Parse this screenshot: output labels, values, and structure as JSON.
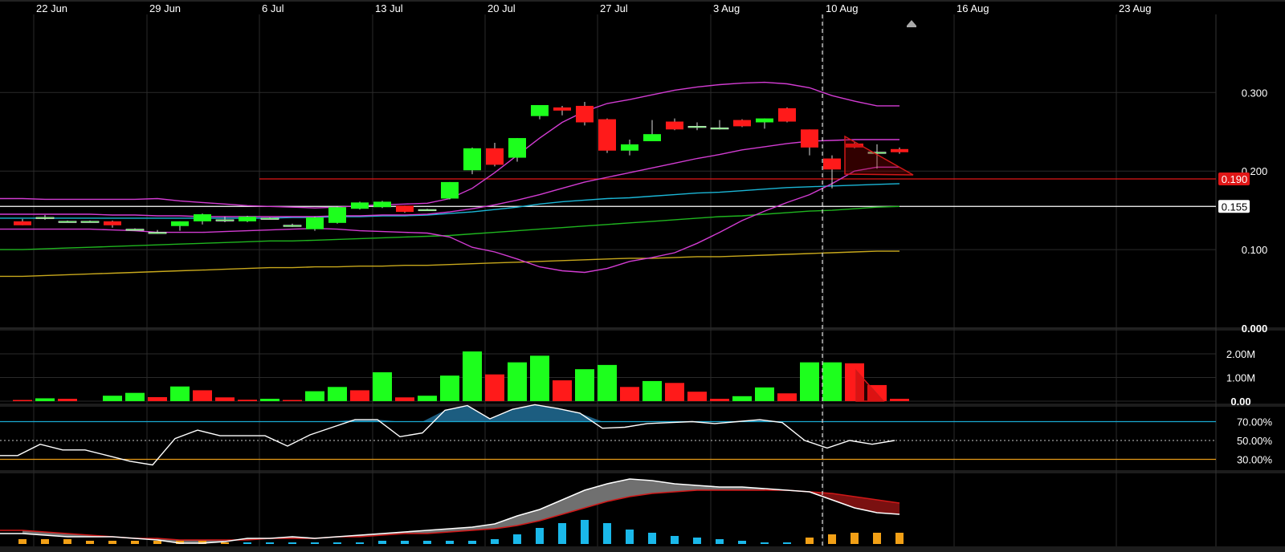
{
  "colors": {
    "background": "#000000",
    "grid": "#2a2a2a",
    "up": "#1dff1d",
    "down": "#ff1a1a",
    "bollinger": "#d23cd2",
    "ma_cyan": "#1bb6d6",
    "ma_green": "#1fb51f",
    "ma_yellow": "#c8a81c",
    "rsi_line": "#ffffff",
    "rsi_upper": "#1aa9d0",
    "rsi_lower": "#e89a18",
    "macd_line": "#ffffff",
    "macd_signal": "#d01818",
    "macd_hist_pos": "#1ab8ea",
    "macd_hist_neg": "#f2a016",
    "h_line_red": "#e01616",
    "h_line_white": "#ffffff"
  },
  "chart_data": [
    {
      "type": "candlestick",
      "panel": "price",
      "x_axis_labels": [
        "22 Jun",
        "29 Jun",
        "6 Jul",
        "13 Jul",
        "20 Jul",
        "27 Jul",
        "3 Aug",
        "10 Aug",
        "16 Aug",
        "23 Aug"
      ],
      "y_tick_labels": [
        "0.300",
        "0.200",
        "0.100",
        "0.000"
      ],
      "ylim": [
        0.0,
        0.3
      ],
      "h_levels": [
        {
          "value": 0.19,
          "label": "0.190",
          "color": "red"
        },
        {
          "value": 0.155,
          "label": "0.155",
          "color": "white"
        }
      ],
      "candles": [
        {
          "o": 0.136,
          "h": 0.139,
          "l": 0.131,
          "c": 0.131
        },
        {
          "o": 0.141,
          "h": 0.144,
          "l": 0.138,
          "c": 0.141
        },
        {
          "o": 0.136,
          "h": 0.137,
          "l": 0.135,
          "c": 0.136
        },
        {
          "o": 0.136,
          "h": 0.137,
          "l": 0.135,
          "c": 0.136
        },
        {
          "o": 0.136,
          "h": 0.137,
          "l": 0.128,
          "c": 0.131
        },
        {
          "o": 0.126,
          "h": 0.127,
          "l": 0.124,
          "c": 0.126
        },
        {
          "o": 0.122,
          "h": 0.125,
          "l": 0.12,
          "c": 0.122
        },
        {
          "o": 0.13,
          "h": 0.136,
          "l": 0.124,
          "c": 0.136
        },
        {
          "o": 0.136,
          "h": 0.146,
          "l": 0.132,
          "c": 0.145
        },
        {
          "o": 0.138,
          "h": 0.142,
          "l": 0.135,
          "c": 0.138
        },
        {
          "o": 0.136,
          "h": 0.143,
          "l": 0.135,
          "c": 0.142
        },
        {
          "o": 0.14,
          "h": 0.141,
          "l": 0.139,
          "c": 0.14
        },
        {
          "o": 0.131,
          "h": 0.133,
          "l": 0.129,
          "c": 0.131
        },
        {
          "o": 0.126,
          "h": 0.142,
          "l": 0.124,
          "c": 0.141
        },
        {
          "o": 0.134,
          "h": 0.155,
          "l": 0.133,
          "c": 0.154
        },
        {
          "o": 0.152,
          "h": 0.161,
          "l": 0.151,
          "c": 0.16
        },
        {
          "o": 0.154,
          "h": 0.162,
          "l": 0.153,
          "c": 0.161
        },
        {
          "o": 0.156,
          "h": 0.156,
          "l": 0.147,
          "c": 0.148
        },
        {
          "o": 0.151,
          "h": 0.152,
          "l": 0.15,
          "c": 0.151
        },
        {
          "o": 0.165,
          "h": 0.186,
          "l": 0.164,
          "c": 0.186
        },
        {
          "o": 0.201,
          "h": 0.23,
          "l": 0.196,
          "c": 0.229
        },
        {
          "o": 0.229,
          "h": 0.236,
          "l": 0.206,
          "c": 0.208
        },
        {
          "o": 0.217,
          "h": 0.242,
          "l": 0.212,
          "c": 0.242
        },
        {
          "o": 0.27,
          "h": 0.284,
          "l": 0.266,
          "c": 0.284
        },
        {
          "o": 0.281,
          "h": 0.283,
          "l": 0.271,
          "c": 0.277
        },
        {
          "o": 0.283,
          "h": 0.288,
          "l": 0.258,
          "c": 0.262
        },
        {
          "o": 0.266,
          "h": 0.267,
          "l": 0.223,
          "c": 0.226
        },
        {
          "o": 0.226,
          "h": 0.24,
          "l": 0.22,
          "c": 0.234
        },
        {
          "o": 0.238,
          "h": 0.265,
          "l": 0.238,
          "c": 0.247
        },
        {
          "o": 0.263,
          "h": 0.267,
          "l": 0.252,
          "c": 0.253
        },
        {
          "o": 0.257,
          "h": 0.262,
          "l": 0.252,
          "c": 0.257
        },
        {
          "o": 0.255,
          "h": 0.265,
          "l": 0.253,
          "c": 0.255
        },
        {
          "o": 0.265,
          "h": 0.266,
          "l": 0.256,
          "c": 0.257
        },
        {
          "o": 0.262,
          "h": 0.267,
          "l": 0.254,
          "c": 0.267
        },
        {
          "o": 0.28,
          "h": 0.281,
          "l": 0.262,
          "c": 0.263
        },
        {
          "o": 0.253,
          "h": 0.253,
          "l": 0.22,
          "c": 0.23
        },
        {
          "o": 0.216,
          "h": 0.22,
          "l": 0.178,
          "c": 0.202
        },
        {
          "o": 0.235,
          "h": 0.238,
          "l": 0.229,
          "c": 0.23
        },
        {
          "o": 0.224,
          "h": 0.234,
          "l": 0.203,
          "c": 0.224
        },
        {
          "o": 0.228,
          "h": 0.23,
          "l": 0.222,
          "c": 0.224
        }
      ],
      "bollinger_upper": [
        0.165,
        0.164,
        0.164,
        0.164,
        0.164,
        0.164,
        0.165,
        0.162,
        0.16,
        0.158,
        0.156,
        0.155,
        0.154,
        0.153,
        0.154,
        0.156,
        0.157,
        0.158,
        0.159,
        0.165,
        0.178,
        0.198,
        0.22,
        0.242,
        0.262,
        0.276,
        0.286,
        0.291,
        0.297,
        0.303,
        0.307,
        0.31,
        0.312,
        0.313,
        0.311,
        0.306,
        0.296,
        0.289,
        0.283,
        0.283
      ],
      "bollinger_mid": [
        0.145,
        0.145,
        0.145,
        0.145,
        0.144,
        0.144,
        0.143,
        0.143,
        0.142,
        0.142,
        0.142,
        0.142,
        0.142,
        0.142,
        0.143,
        0.143,
        0.144,
        0.144,
        0.145,
        0.148,
        0.152,
        0.157,
        0.163,
        0.17,
        0.178,
        0.186,
        0.192,
        0.198,
        0.204,
        0.21,
        0.216,
        0.221,
        0.227,
        0.231,
        0.235,
        0.238,
        0.239,
        0.24,
        0.24,
        0.24
      ],
      "bollinger_lower": [
        0.126,
        0.126,
        0.126,
        0.126,
        0.125,
        0.124,
        0.122,
        0.122,
        0.122,
        0.123,
        0.124,
        0.125,
        0.126,
        0.127,
        0.126,
        0.124,
        0.123,
        0.122,
        0.121,
        0.116,
        0.103,
        0.097,
        0.088,
        0.078,
        0.073,
        0.071,
        0.076,
        0.085,
        0.09,
        0.096,
        0.108,
        0.122,
        0.137,
        0.149,
        0.16,
        0.17,
        0.184,
        0.2,
        0.205,
        0.205
      ],
      "ma_cyan": [
        0.14,
        0.14,
        0.14,
        0.14,
        0.14,
        0.14,
        0.14,
        0.14,
        0.14,
        0.14,
        0.14,
        0.14,
        0.141,
        0.141,
        0.142,
        0.142,
        0.143,
        0.143,
        0.144,
        0.146,
        0.148,
        0.151,
        0.154,
        0.158,
        0.161,
        0.163,
        0.165,
        0.166,
        0.168,
        0.17,
        0.172,
        0.173,
        0.175,
        0.177,
        0.179,
        0.18,
        0.181,
        0.182,
        0.183,
        0.184
      ],
      "ma_green": [
        0.1,
        0.101,
        0.102,
        0.103,
        0.104,
        0.105,
        0.106,
        0.107,
        0.108,
        0.109,
        0.11,
        0.111,
        0.111,
        0.112,
        0.113,
        0.114,
        0.115,
        0.116,
        0.117,
        0.118,
        0.12,
        0.122,
        0.124,
        0.126,
        0.128,
        0.13,
        0.132,
        0.134,
        0.136,
        0.138,
        0.14,
        0.142,
        0.143,
        0.145,
        0.147,
        0.149,
        0.15,
        0.152,
        0.154,
        0.155
      ],
      "ma_yellow": [
        0.066,
        0.067,
        0.068,
        0.069,
        0.07,
        0.071,
        0.072,
        0.073,
        0.074,
        0.075,
        0.076,
        0.077,
        0.077,
        0.078,
        0.078,
        0.079,
        0.079,
        0.08,
        0.08,
        0.081,
        0.082,
        0.083,
        0.084,
        0.085,
        0.086,
        0.087,
        0.088,
        0.089,
        0.089,
        0.09,
        0.091,
        0.091,
        0.092,
        0.093,
        0.094,
        0.095,
        0.096,
        0.097,
        0.098,
        0.098
      ]
    },
    {
      "type": "bar",
      "panel": "volume",
      "y_tick_labels": [
        "2.00M",
        "1.00M",
        "0.00"
      ],
      "ylim": [
        0,
        2.2
      ],
      "values": [
        0.04,
        0.12,
        0.1,
        0.0,
        0.23,
        0.35,
        0.17,
        0.62,
        0.46,
        0.16,
        0.06,
        0.1,
        0.02,
        0.42,
        0.6,
        0.46,
        1.22,
        0.16,
        0.23,
        1.08,
        2.1,
        1.13,
        1.64,
        1.92,
        0.88,
        1.35,
        1.53,
        0.6,
        0.85,
        0.77,
        0.4,
        0.1,
        0.21,
        0.58,
        0.33,
        1.64,
        1.64,
        1.6,
        0.68,
        0.1
      ],
      "direction": [
        "dn",
        "up",
        "dn",
        "dn",
        "up",
        "up",
        "dn",
        "up",
        "dn",
        "dn",
        "dn",
        "up",
        "dn",
        "up",
        "up",
        "dn",
        "up",
        "dn",
        "up",
        "up",
        "up",
        "dn",
        "up",
        "up",
        "dn",
        "up",
        "up",
        "dn",
        "up",
        "dn",
        "dn",
        "dn",
        "up",
        "up",
        "dn",
        "up",
        "up",
        "dn",
        "dn",
        "dn"
      ]
    },
    {
      "type": "line",
      "panel": "rsi",
      "y_tick_labels": [
        "70.00%",
        "50.00%",
        "30.00%"
      ],
      "ylim": [
        20,
        100
      ],
      "thresholds": [
        70,
        50,
        30
      ],
      "values": [
        34,
        34,
        46,
        40,
        40,
        34,
        28,
        24,
        52,
        61,
        55,
        55,
        55,
        44,
        56,
        64,
        72,
        72,
        54,
        58,
        82,
        87,
        73,
        83,
        88,
        84,
        79,
        63,
        64,
        68,
        69,
        70,
        68,
        70,
        72,
        69,
        50,
        42,
        50,
        46,
        50
      ]
    },
    {
      "type": "line",
      "panel": "macd",
      "ylim": [
        -0.012,
        0.04
      ],
      "macd": [
        0.0,
        -0.001,
        -0.002,
        -0.002,
        -0.002,
        -0.003,
        -0.004,
        -0.006,
        -0.006,
        -0.005,
        -0.003,
        -0.003,
        -0.002,
        -0.003,
        -0.002,
        -0.001,
        0.0,
        0.001,
        0.002,
        0.003,
        0.004,
        0.006,
        0.011,
        0.015,
        0.021,
        0.027,
        0.031,
        0.034,
        0.033,
        0.031,
        0.03,
        0.029,
        0.029,
        0.028,
        0.027,
        0.026,
        0.021,
        0.016,
        0.013,
        0.012
      ],
      "signal": [
        0.002,
        0.001,
        0.0,
        -0.001,
        -0.002,
        -0.003,
        -0.003,
        -0.004,
        -0.004,
        -0.004,
        -0.004,
        -0.003,
        -0.003,
        -0.003,
        -0.002,
        -0.002,
        -0.001,
        0.0,
        0.0,
        0.001,
        0.002,
        0.003,
        0.005,
        0.008,
        0.012,
        0.016,
        0.02,
        0.023,
        0.025,
        0.026,
        0.027,
        0.027,
        0.027,
        0.027,
        0.027,
        0.026,
        0.025,
        0.023,
        0.021,
        0.019
      ],
      "histogram": [
        -0.003,
        -0.003,
        -0.003,
        -0.002,
        -0.002,
        -0.002,
        -0.002,
        -0.002,
        -0.002,
        -0.001,
        0.0,
        0.0,
        0.0,
        0.0,
        0.001,
        0.001,
        0.002,
        0.002,
        0.002,
        0.002,
        0.002,
        0.003,
        0.006,
        0.01,
        0.013,
        0.015,
        0.013,
        0.009,
        0.007,
        0.005,
        0.004,
        0.003,
        0.002,
        0.001,
        0.001,
        -0.004,
        -0.006,
        -0.007,
        -0.007,
        -0.007
      ]
    }
  ]
}
